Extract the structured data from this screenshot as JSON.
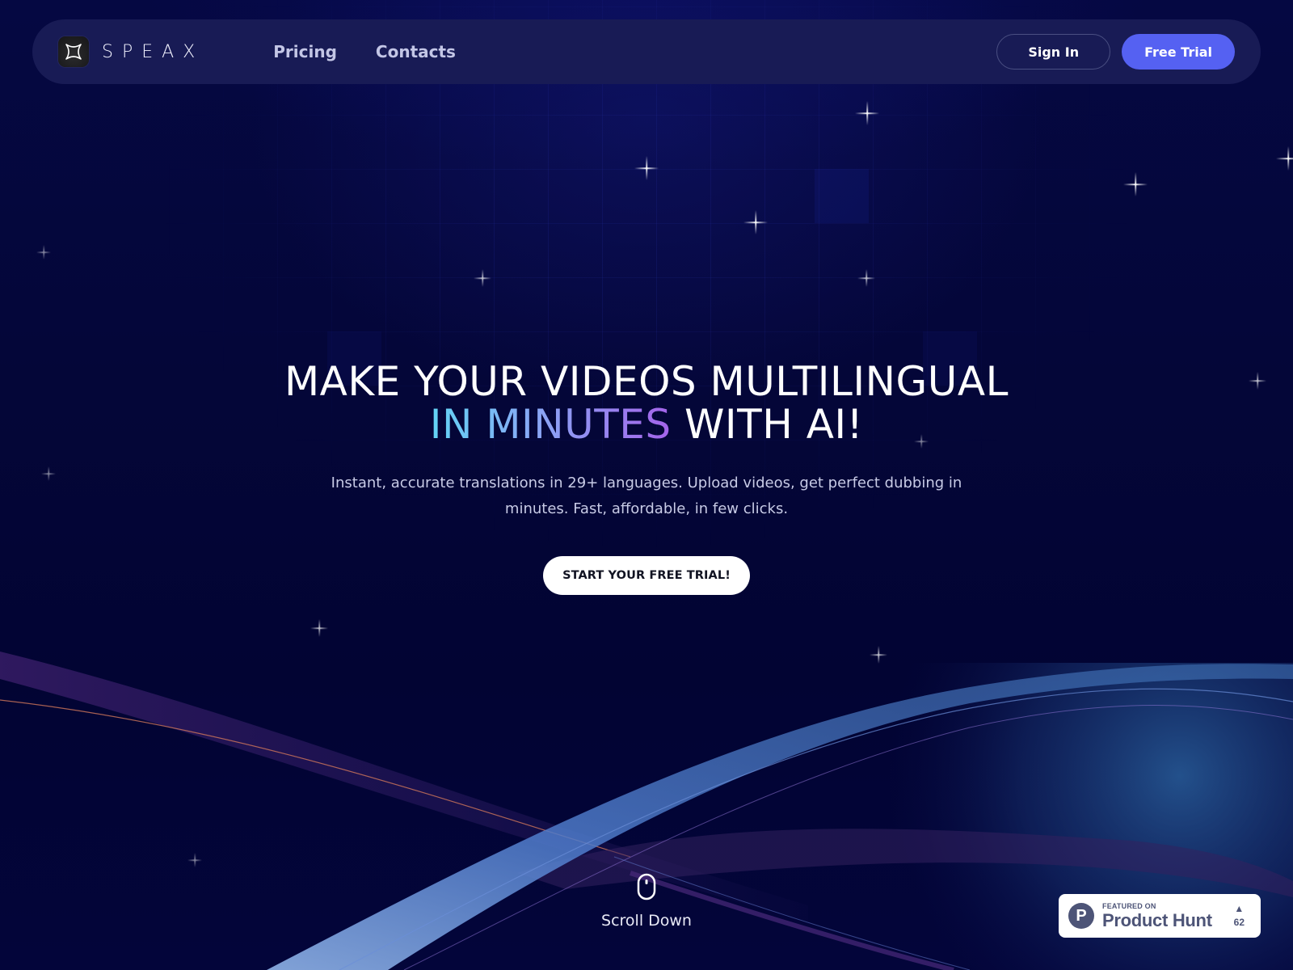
{
  "brand": {
    "name": "SPEAX",
    "logo_icon": "four-point-star-icon"
  },
  "nav": {
    "links": [
      {
        "label": "Pricing"
      },
      {
        "label": "Contacts"
      }
    ],
    "sign_in_label": "Sign In",
    "free_trial_label": "Free Trial"
  },
  "hero": {
    "headline_line1": "MAKE YOUR VIDEOS MULTILINGUAL",
    "headline_highlight": "IN MINUTES",
    "headline_rest": " WITH AI!",
    "subtitle": "Instant, accurate translations in 29+ languages. Upload videos, get perfect dubbing in minutes. Fast, affordable, in few clicks.",
    "cta_label": "START YOUR FREE TRIAL!"
  },
  "scroll": {
    "icon": "mouse-icon",
    "label": "Scroll Down"
  },
  "product_hunt": {
    "featured_label": "FEATURED ON",
    "name": "Product Hunt",
    "logo_letter": "P",
    "upvote_icon": "▲",
    "upvotes": "62"
  },
  "colors": {
    "background": "#03043a",
    "nav_bg": "#181b55",
    "primary": "#5561f2",
    "gradient_start": "#62d4f5",
    "gradient_end": "#a463ea",
    "product_hunt_gray": "#4d5477"
  }
}
